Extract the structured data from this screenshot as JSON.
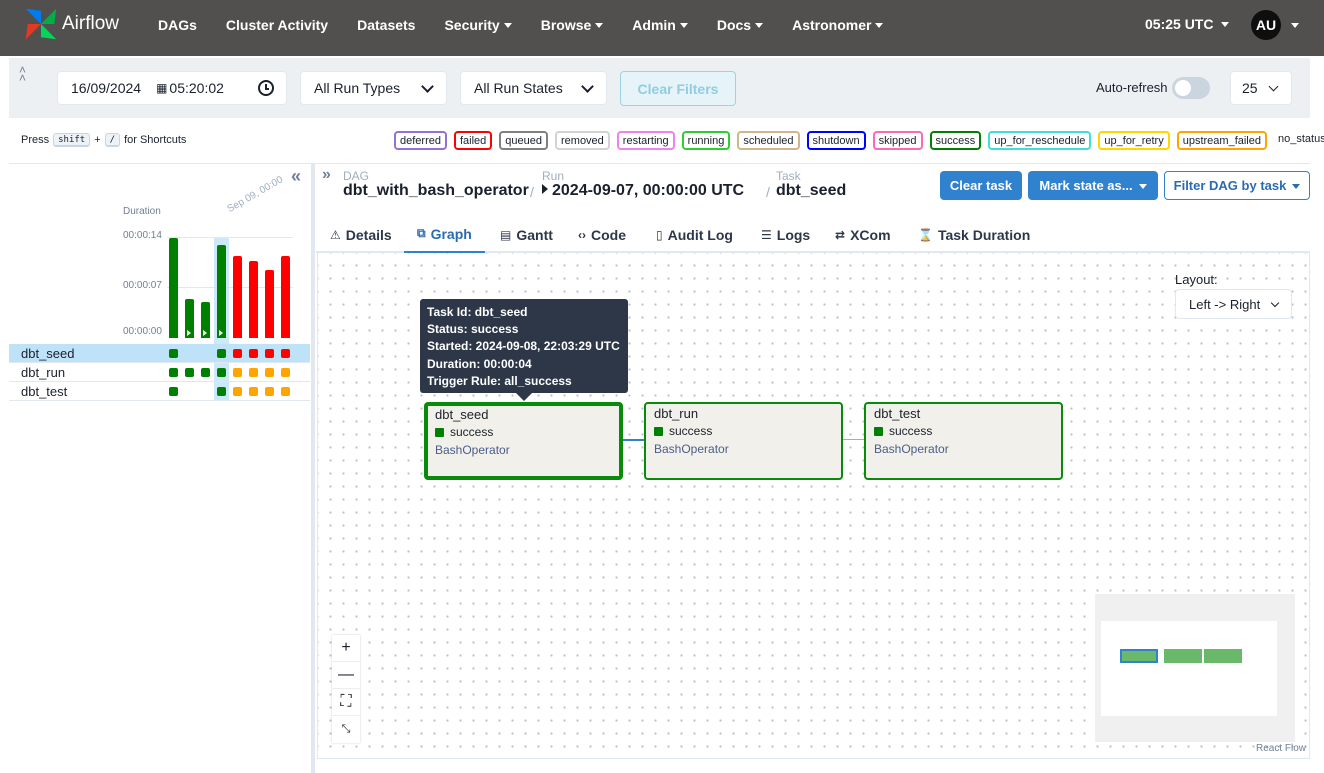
{
  "nav": {
    "brand": "Airflow",
    "items": [
      {
        "label": "DAGs",
        "dropdown": false
      },
      {
        "label": "Cluster Activity",
        "dropdown": false
      },
      {
        "label": "Datasets",
        "dropdown": false
      },
      {
        "label": "Security",
        "dropdown": true
      },
      {
        "label": "Browse",
        "dropdown": true
      },
      {
        "label": "Admin",
        "dropdown": true
      },
      {
        "label": "Docs",
        "dropdown": true
      },
      {
        "label": "Astronomer",
        "dropdown": true
      }
    ],
    "time": "05:25 UTC",
    "user_initials": "AU"
  },
  "filters": {
    "date": "16/09/2024",
    "time": "05:20:02",
    "run_types": "All Run Types",
    "run_states": "All Run States",
    "clear_label": "Clear Filters",
    "auto_refresh_label": "Auto-refresh",
    "num_runs": "25"
  },
  "shortcuts": {
    "press": "Press",
    "key1": "shift",
    "plus": "+",
    "key2": "/",
    "suffix": "for Shortcuts"
  },
  "legend": [
    {
      "label": "deferred",
      "color": "#9370db"
    },
    {
      "label": "failed",
      "color": "#ff0000"
    },
    {
      "label": "queued",
      "color": "#808080"
    },
    {
      "label": "removed",
      "color": "#d3d3d3"
    },
    {
      "label": "restarting",
      "color": "#ee82ee"
    },
    {
      "label": "running",
      "color": "#32cd32"
    },
    {
      "label": "scheduled",
      "color": "#d2b48c"
    },
    {
      "label": "shutdown",
      "color": "#0000ff"
    },
    {
      "label": "skipped",
      "color": "#ff69b4"
    },
    {
      "label": "success",
      "color": "#008000"
    },
    {
      "label": "up_for_reschedule",
      "color": "#40e0d0"
    },
    {
      "label": "up_for_retry",
      "color": "#ffd700"
    },
    {
      "label": "upstream_failed",
      "color": "#ffa500"
    },
    {
      "label": "no_status",
      "color": ""
    }
  ],
  "grid": {
    "duration_label": "Duration",
    "date_label": "Sep 09, 00:00",
    "ticks": [
      "00:00:14",
      "00:00:07",
      "00:00:00"
    ],
    "max_seconds": 14,
    "runs": [
      {
        "seconds": 14,
        "state": "success",
        "manual": false
      },
      {
        "seconds": 5.5,
        "state": "success",
        "manual": true
      },
      {
        "seconds": 5,
        "state": "success",
        "manual": true
      },
      {
        "seconds": 13,
        "state": "success",
        "manual": true
      },
      {
        "seconds": 11.5,
        "state": "failed",
        "manual": false
      },
      {
        "seconds": 10.8,
        "state": "failed",
        "manual": false
      },
      {
        "seconds": 9.5,
        "state": "failed",
        "manual": false
      },
      {
        "seconds": 11.5,
        "state": "failed",
        "manual": false
      }
    ],
    "tasks": [
      {
        "name": "dbt_seed",
        "cells": [
          "success",
          "",
          "",
          "success",
          "failed",
          "failed",
          "failed",
          "failed"
        ]
      },
      {
        "name": "dbt_run",
        "cells": [
          "success",
          "success",
          "success",
          "success",
          "upstream_failed",
          "upstream_failed",
          "upstream_failed",
          "upstream_failed"
        ]
      },
      {
        "name": "dbt_test",
        "cells": [
          "success",
          "",
          "",
          "success",
          "upstream_failed",
          "upstream_failed",
          "upstream_failed",
          "upstream_failed"
        ]
      }
    ]
  },
  "breadcrumb": {
    "dag_cap": "DAG",
    "dag": "dbt_with_bash_operator",
    "run_cap": "Run",
    "run": "2024-09-07, 00:00:00 UTC",
    "task_cap": "Task",
    "task": "dbt_seed"
  },
  "actions": {
    "clear": "Clear task",
    "mark": "Mark state as...",
    "filter": "Filter DAG by task"
  },
  "tabs": [
    {
      "label": "Details",
      "icon": "⚠"
    },
    {
      "label": "Graph",
      "icon": "⧉"
    },
    {
      "label": "Gantt",
      "icon": "▤"
    },
    {
      "label": "Code",
      "icon": "‹›"
    },
    {
      "label": "Audit Log",
      "icon": "▯"
    },
    {
      "label": "Logs",
      "icon": "☰"
    },
    {
      "label": "XCom",
      "icon": "⇄"
    },
    {
      "label": "Task Duration",
      "icon": "⌛"
    }
  ],
  "graph": {
    "layout_label": "Layout:",
    "layout_value": "Left -> Right",
    "tooltip": {
      "task_id": "Task Id: dbt_seed",
      "status": "Status: success",
      "started": "Started: 2024-09-08, 22:03:29 UTC",
      "duration": "Duration: 00:00:04",
      "trigger": "Trigger Rule: all_success"
    },
    "nodes": [
      {
        "name": "dbt_seed",
        "status": "success",
        "operator": "BashOperator"
      },
      {
        "name": "dbt_run",
        "status": "success",
        "operator": "BashOperator"
      },
      {
        "name": "dbt_test",
        "status": "success",
        "operator": "BashOperator"
      }
    ],
    "attribution": "React Flow"
  },
  "colors": {
    "success": "#008000",
    "failed": "#ff0000",
    "upstream_failed": "#ffa500",
    "accent": "#3182ce"
  }
}
